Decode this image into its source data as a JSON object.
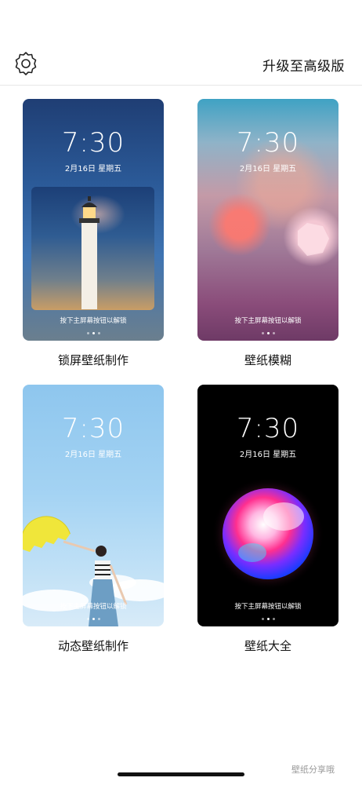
{
  "header": {
    "settings_icon": "gear-icon",
    "upgrade_label": "升级至高级版"
  },
  "cards": [
    {
      "time": "7:30",
      "date": "2月16日 星期五",
      "hint": "按下主屏幕按钮以解锁",
      "caption": "锁屏壁纸制作"
    },
    {
      "time": "7:30",
      "date": "2月16日 星期五",
      "hint": "按下主屏幕按钮以解锁",
      "caption": "壁纸模糊"
    },
    {
      "time": "7:30",
      "date": "2月16日 星期五",
      "hint": "按下主屏幕按钮以解锁",
      "caption": "动态壁纸制作"
    },
    {
      "time": "7:30",
      "date": "2月16日 星期五",
      "hint": "按下主屏幕按钮以解锁",
      "caption": "壁纸大全"
    }
  ],
  "watermark": "壁纸分享哦"
}
